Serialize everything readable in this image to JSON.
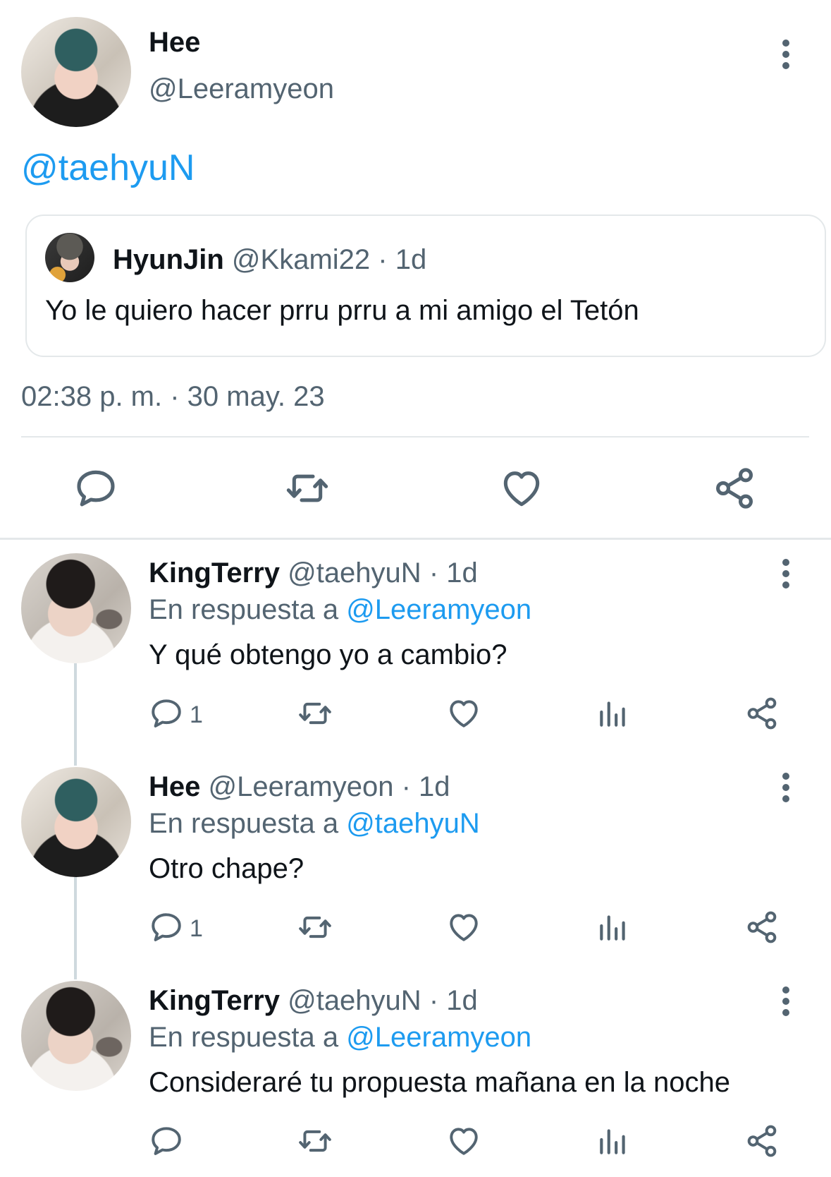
{
  "main_tweet": {
    "author_name": "Hee",
    "author_handle": "@Leeramyeon",
    "text": "@taehyuN",
    "quoted": {
      "author_name": "HyunJin",
      "author_handle": "@Kkami22",
      "time": "· 1d",
      "text": "Yo le quiero hacer prru prru a mi amigo el Tetón"
    },
    "timestamp": "02:38 p. m. · 30 may. 23"
  },
  "replies": [
    {
      "author_name": "KingTerry",
      "author_handle": "@taehyuN",
      "time": "· 1d",
      "reply_prefix": "En respuesta a",
      "reply_to": "@Leeramyeon",
      "text": "Y qué obtengo yo a cambio?",
      "reply_count": "1"
    },
    {
      "author_name": "Hee",
      "author_handle": "@Leeramyeon",
      "time": "· 1d",
      "reply_prefix": "En respuesta a",
      "reply_to": "@taehyuN",
      "text": "Otro chape?",
      "reply_count": "1"
    },
    {
      "author_name": "KingTerry",
      "author_handle": "@taehyuN",
      "time": "· 1d",
      "reply_prefix": "En respuesta a",
      "reply_to": "@Leeramyeon",
      "text": "Consideraré tu propuesta mañana en la noche",
      "reply_count": ""
    }
  ],
  "icons": [
    "reply-icon",
    "retweet-icon",
    "like-icon",
    "share-icon",
    "views-icon",
    "more-icon"
  ],
  "colors": {
    "link": "#1d9bf0",
    "muted": "#536471",
    "text": "#0f1419"
  }
}
